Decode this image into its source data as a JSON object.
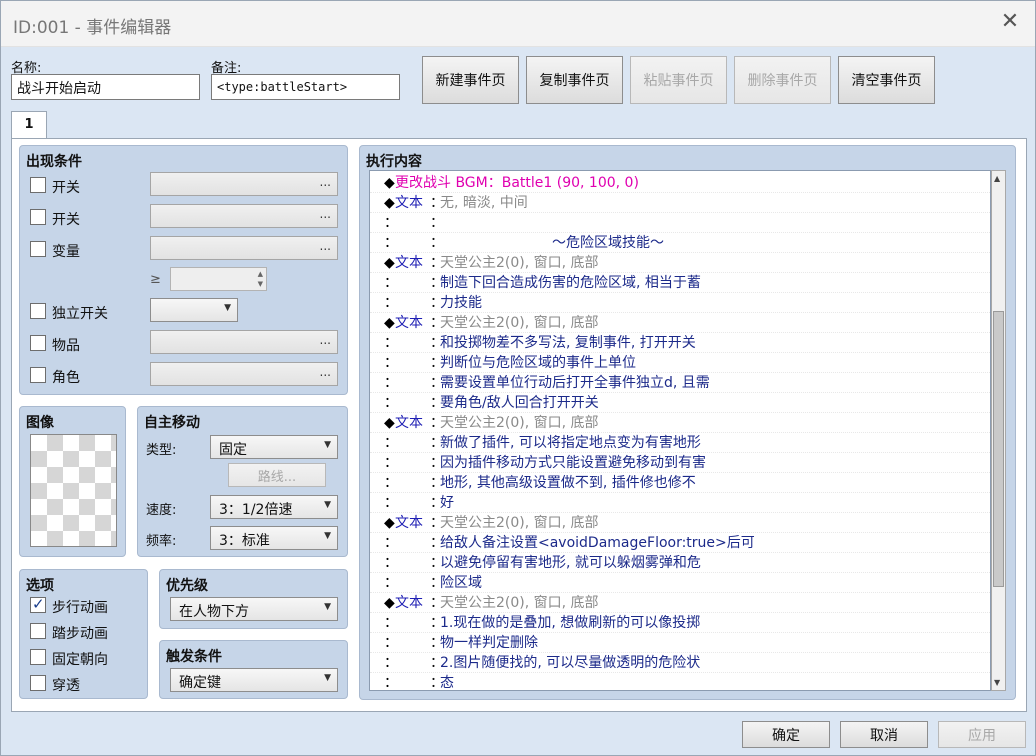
{
  "window": {
    "title": "ID:001 - 事件编辑器",
    "close_icon": "close-icon"
  },
  "header": {
    "name_label": "名称:",
    "name_value": "战斗开始启动",
    "note_label": "备注:",
    "note_value": "<type:battleStart>",
    "buttons": {
      "new_page": "新建事件页",
      "copy_page": "复制事件页",
      "paste_page": "粘贴事件页",
      "delete_page": "删除事件页",
      "clear_page": "清空事件页"
    }
  },
  "tabs": [
    {
      "label": "1"
    }
  ],
  "conditions": {
    "title": "出现条件",
    "switch1_label": "开关",
    "switch1_dots": "...",
    "switch2_label": "开关",
    "switch2_dots": "...",
    "variable_label": "变量",
    "variable_dots": "...",
    "variable_ge": "≥",
    "self_switch_label": "独立开关",
    "item_label": "物品",
    "item_dots": "...",
    "actor_label": "角色",
    "actor_dots": "..."
  },
  "image": {
    "title": "图像"
  },
  "autonomous": {
    "title": "自主移动",
    "type_label": "类型:",
    "type_value": "固定",
    "route_button": "路线...",
    "speed_label": "速度:",
    "speed_value": "3：1/2倍速",
    "freq_label": "频率:",
    "freq_value": "3：标准"
  },
  "options": {
    "title": "选项",
    "walking": {
      "label": "步行动画",
      "checked": true
    },
    "stepping": {
      "label": "踏步动画",
      "checked": false
    },
    "direction_fix": {
      "label": "固定朝向",
      "checked": false
    },
    "through": {
      "label": "穿透",
      "checked": false
    }
  },
  "priority": {
    "title": "优先级",
    "value": "在人物下方"
  },
  "trigger": {
    "title": "触发条件",
    "value": "确定键"
  },
  "contents": {
    "title": "执行内容",
    "rows": [
      {
        "marker": "◆",
        "head": "更改战斗 BGM：Battle1 (90, 100, 0)",
        "style": "magenta"
      },
      {
        "marker": "◆",
        "head": "文本",
        "sep": "：",
        "text": "无, 暗淡, 中间",
        "style": "gray"
      },
      {
        "marker": "：",
        "sep": "：",
        "text": ""
      },
      {
        "marker": "：",
        "sep": "：",
        "text": "　　　　　　　　～危险区域技能～",
        "style": "navy"
      },
      {
        "marker": "◆",
        "head": "文本",
        "sep": "：",
        "text": "天堂公主2(0), 窗口, 底部",
        "style": "gray"
      },
      {
        "marker": "：",
        "sep": "：",
        "text": "制造下回合造成伤害的危险区域, 相当于蓄",
        "style": "navy"
      },
      {
        "marker": "：",
        "sep": "：",
        "text": "力技能",
        "style": "navy"
      },
      {
        "marker": "◆",
        "head": "文本",
        "sep": "：",
        "text": "天堂公主2(0), 窗口, 底部",
        "style": "gray"
      },
      {
        "marker": "：",
        "sep": "：",
        "text": "和投掷物差不多写法, 复制事件, 打开开关",
        "style": "navy"
      },
      {
        "marker": "：",
        "sep": "：",
        "text": "判断位与危险区域的事件上单位",
        "style": "navy"
      },
      {
        "marker": "：",
        "sep": "：",
        "text": "需要设置单位行动后打开全事件独立d, 且需",
        "style": "navy"
      },
      {
        "marker": "：",
        "sep": "：",
        "text": "要角色/敌人回合打开开关",
        "style": "navy"
      },
      {
        "marker": "◆",
        "head": "文本",
        "sep": "：",
        "text": "天堂公主2(0), 窗口, 底部",
        "style": "gray"
      },
      {
        "marker": "：",
        "sep": "：",
        "text": "新做了插件, 可以将指定地点变为有害地形",
        "style": "navy"
      },
      {
        "marker": "：",
        "sep": "：",
        "text": "因为插件移动方式只能设置避免移动到有害",
        "style": "navy"
      },
      {
        "marker": "：",
        "sep": "：",
        "text": "地形, 其他高级设置做不到, 插件修也修不",
        "style": "navy"
      },
      {
        "marker": "：",
        "sep": "：",
        "text": "好",
        "style": "navy"
      },
      {
        "marker": "◆",
        "head": "文本",
        "sep": "：",
        "text": "天堂公主2(0), 窗口, 底部",
        "style": "gray"
      },
      {
        "marker": "：",
        "sep": "：",
        "text": "给敌人备注设置<avoidDamageFloor:true>后可",
        "style": "navy"
      },
      {
        "marker": "：",
        "sep": "：",
        "text": "以避免停留有害地形, 就可以躲烟雾弹和危",
        "style": "navy"
      },
      {
        "marker": "：",
        "sep": "：",
        "text": "险区域",
        "style": "navy"
      },
      {
        "marker": "◆",
        "head": "文本",
        "sep": "：",
        "text": "天堂公主2(0), 窗口, 底部",
        "style": "gray"
      },
      {
        "marker": "：",
        "sep": "：",
        "text": "1.现在做的是叠加, 想做刷新的可以像投掷",
        "style": "navy"
      },
      {
        "marker": "：",
        "sep": "：",
        "text": "物一样判定删除",
        "style": "navy"
      },
      {
        "marker": "：",
        "sep": "：",
        "text": "2.图片随便找的, 可以尽量做透明的危险状",
        "style": "navy"
      },
      {
        "marker": "：",
        "sep": "：",
        "text": "态",
        "style": "navy"
      }
    ]
  },
  "footer": {
    "ok": "确定",
    "cancel": "取消",
    "apply": "应用"
  }
}
